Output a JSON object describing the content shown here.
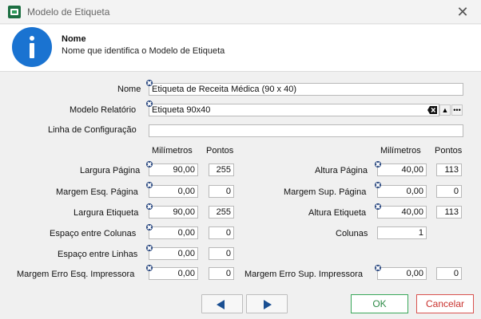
{
  "window": {
    "title": "Modelo de Etiqueta",
    "close_glyph": "✕"
  },
  "header": {
    "title": "Nome",
    "description": "Nome que identifica o Modelo de Etiqueta",
    "icon": "info-icon"
  },
  "form": {
    "nome": {
      "label": "Nome",
      "value": "Etiqueta de Receita Médica (90 x 40)"
    },
    "modelo_relatorio": {
      "label": "Modelo Relatório",
      "value": "Etiqueta 90x40",
      "buttons": {
        "up": "▲",
        "more": "•••"
      }
    },
    "linha_configuracao": {
      "label": "Linha de Configuração",
      "value": ""
    },
    "columns_left": {
      "mm": "Milímetros",
      "pt": "Pontos"
    },
    "columns_right": {
      "mm": "Milímetros",
      "pt": "Pontos"
    },
    "left": [
      {
        "label": "Largura Página",
        "mm": "90,00",
        "pt": "255"
      },
      {
        "label": "Margem Esq. Página",
        "mm": "0,00",
        "pt": "0"
      },
      {
        "label": "Largura Etiqueta",
        "mm": "90,00",
        "pt": "255"
      },
      {
        "label": "Espaço entre Colunas",
        "mm": "0,00",
        "pt": "0"
      },
      {
        "label": "Espaço entre Linhas",
        "mm": "0,00",
        "pt": "0"
      },
      {
        "label": "Margem Erro Esq. Impressora",
        "mm": "0,00",
        "pt": "0"
      }
    ],
    "right": [
      {
        "label": "Altura Página",
        "mm": "40,00",
        "pt": "113"
      },
      {
        "label": "Margem Sup. Página",
        "mm": "0,00",
        "pt": "0"
      },
      {
        "label": "Altura Etiqueta",
        "mm": "40,00",
        "pt": "113"
      },
      {
        "label": "Colunas",
        "mm": "1"
      },
      {
        "label": "Margem Erro Sup. Impressora",
        "mm": "0,00",
        "pt": "0"
      }
    ]
  },
  "footer": {
    "ok": "OK",
    "cancel": "Cancelar"
  }
}
